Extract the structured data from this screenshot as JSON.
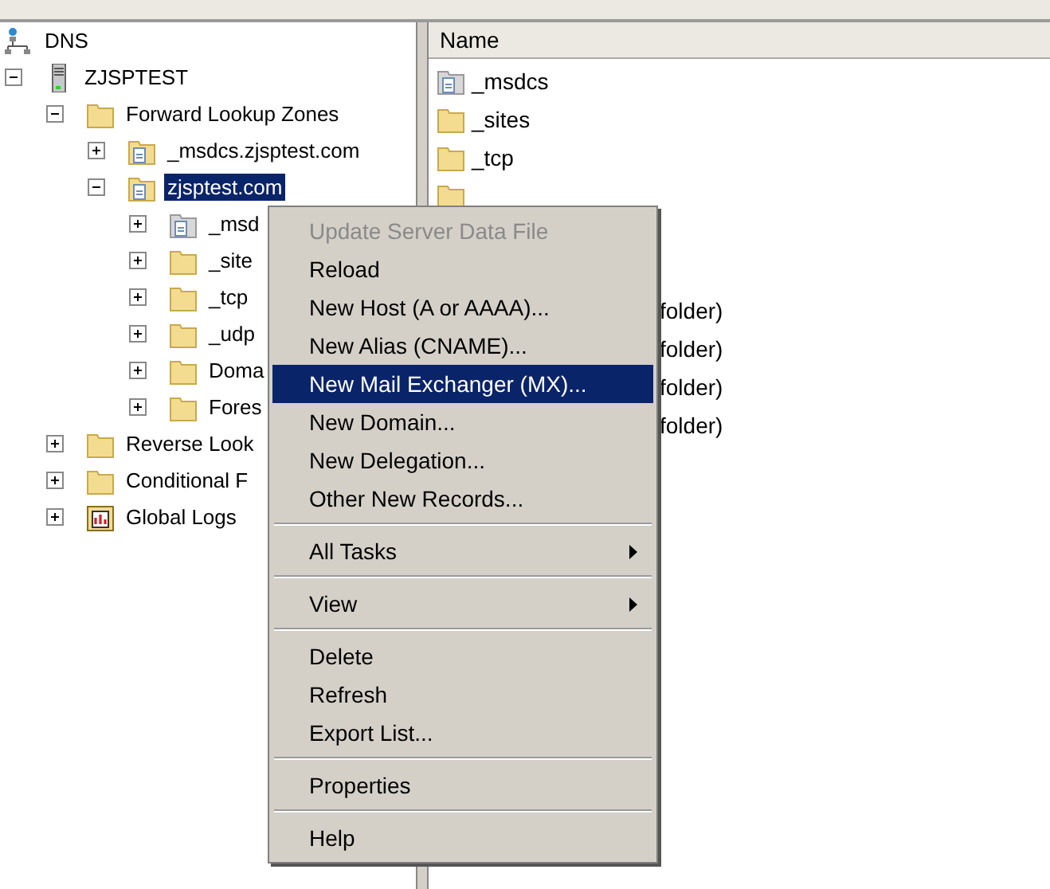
{
  "tree": [
    {
      "label": "DNS",
      "kind": "network",
      "selected": false,
      "children": [
        {
          "label": "ZJSPTEST",
          "kind": "server",
          "expanded": true,
          "selected": false,
          "children": [
            {
              "label": "Forward Lookup Zones",
              "kind": "folder",
              "expanded": true,
              "selected": false,
              "children": [
                {
                  "label": "_msdcs.zjsptest.com",
                  "kind": "zone",
                  "expanded": false,
                  "selected": false
                },
                {
                  "label": "zjsptest.com",
                  "kind": "zone",
                  "expanded": true,
                  "selected": true,
                  "children": [
                    {
                      "label": "_msd",
                      "kind": "delegation",
                      "expanded": false,
                      "selected": false
                    },
                    {
                      "label": "_site",
                      "kind": "folder",
                      "expanded": false,
                      "selected": false
                    },
                    {
                      "label": "_tcp",
                      "kind": "folder",
                      "expanded": false,
                      "selected": false
                    },
                    {
                      "label": "_udp",
                      "kind": "folder",
                      "expanded": false,
                      "selected": false
                    },
                    {
                      "label": "Doma",
                      "kind": "folder",
                      "expanded": false,
                      "selected": false
                    },
                    {
                      "label": "Fores",
                      "kind": "folder",
                      "expanded": false,
                      "selected": false
                    }
                  ]
                }
              ]
            },
            {
              "label": "Reverse Look",
              "kind": "folder",
              "expanded": false,
              "selected": false
            },
            {
              "label": "Conditional F",
              "kind": "folder",
              "expanded": false,
              "selected": false
            },
            {
              "label": "Global Logs",
              "kind": "log",
              "expanded": false,
              "selected": false
            }
          ]
        }
      ]
    }
  ],
  "list": {
    "columns": [
      "Name"
    ],
    "rows": [
      {
        "name": "_msdcs",
        "kind": "delegation"
      },
      {
        "name": "_sites",
        "kind": "folder"
      },
      {
        "name": "_tcp",
        "kind": "folder"
      },
      {
        "kind": "folder"
      }
    ],
    "column_2": [
      "folder)",
      "folder)",
      "folder)",
      "folder)"
    ]
  },
  "context_menu": [
    {
      "kind": "item",
      "label": "Update Server Data File",
      "disabled": true,
      "selected": false
    },
    {
      "kind": "item",
      "label": "Reload",
      "disabled": false,
      "selected": false
    },
    {
      "kind": "item",
      "label": "New Host (A or AAAA)...",
      "disabled": false,
      "selected": false
    },
    {
      "kind": "item",
      "label": "New Alias (CNAME)...",
      "disabled": false,
      "selected": false
    },
    {
      "kind": "item",
      "label": "New Mail Exchanger (MX)...",
      "disabled": false,
      "selected": true
    },
    {
      "kind": "item",
      "label": "New Domain...",
      "disabled": false,
      "selected": false
    },
    {
      "kind": "item",
      "label": "New Delegation...",
      "disabled": false,
      "selected": false
    },
    {
      "kind": "item",
      "label": "Other New Records...",
      "disabled": false,
      "selected": false
    },
    {
      "kind": "separator"
    },
    {
      "kind": "submenu",
      "label": "All Tasks",
      "disabled": false,
      "selected": false
    },
    {
      "kind": "separator"
    },
    {
      "kind": "submenu",
      "label": "View",
      "disabled": false,
      "selected": false
    },
    {
      "kind": "separator"
    },
    {
      "kind": "item",
      "label": "Delete",
      "disabled": false,
      "selected": false
    },
    {
      "kind": "item",
      "label": "Refresh",
      "disabled": false,
      "selected": false
    },
    {
      "kind": "item",
      "label": "Export List...",
      "disabled": false,
      "selected": false
    },
    {
      "kind": "separator"
    },
    {
      "kind": "item",
      "label": "Properties",
      "disabled": false,
      "selected": false
    },
    {
      "kind": "separator"
    },
    {
      "kind": "item",
      "label": "Help",
      "disabled": false,
      "selected": false
    }
  ]
}
